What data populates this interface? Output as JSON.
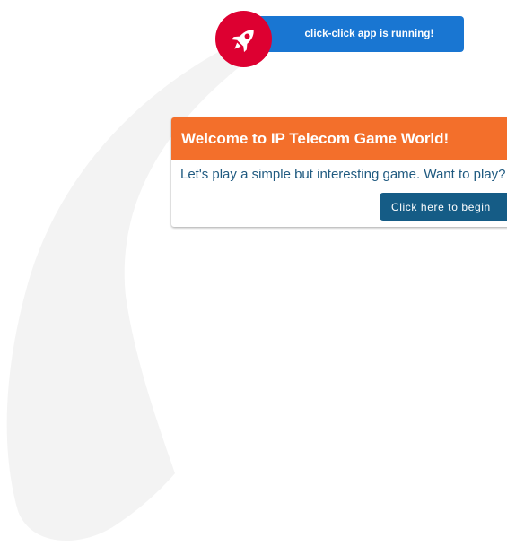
{
  "banner": {
    "message": "click-click app is running!",
    "icon": "rocket-icon",
    "badge_color": "#dd0031",
    "bar_color": "#1976d2"
  },
  "card": {
    "title": "Welcome to IP Telecom Game World!",
    "text": "Let's play a simple but interesting game. Want to play?",
    "button_label": "Click here to begin",
    "header_color": "#f36f2b",
    "button_color": "#155c86"
  }
}
